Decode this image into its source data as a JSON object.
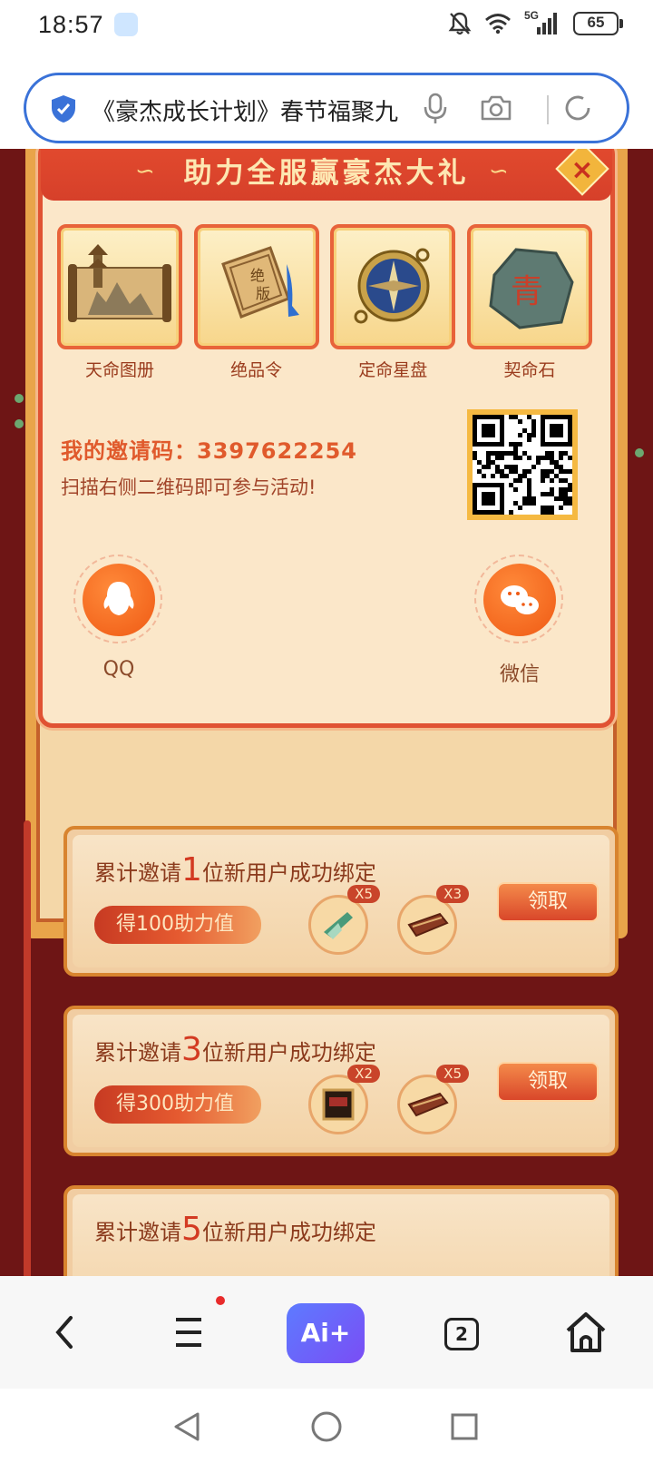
{
  "status": {
    "time": "18:57",
    "network": "5G",
    "battery": "65"
  },
  "browser": {
    "address_text": "《豪杰成长计划》春节福聚九",
    "tabs_count": "2",
    "ai_label": "Ai+"
  },
  "modal": {
    "title": "助力全服赢豪杰大礼",
    "items": [
      {
        "label": "天命图册"
      },
      {
        "label": "绝品令"
      },
      {
        "label": "定命星盘"
      },
      {
        "label": "契命石"
      }
    ],
    "invite_label": "我的邀请码：",
    "invite_code": "3397622254",
    "scan_text": "扫描右侧二维码即可参与活动!",
    "share": [
      {
        "label": "QQ"
      },
      {
        "label": "微信"
      }
    ]
  },
  "tasks": [
    {
      "prefix": "累计邀请",
      "num": "1",
      "suffix": "位新用户成功绑定",
      "badge": "得100助力值",
      "rewards": [
        "X5",
        "X3"
      ],
      "claim": "领取"
    },
    {
      "prefix": "累计邀请",
      "num": "3",
      "suffix": "位新用户成功绑定",
      "badge": "得300助力值",
      "rewards": [
        "X2",
        "X5"
      ],
      "claim": "领取"
    },
    {
      "prefix": "累计邀请",
      "num": "5",
      "suffix": "位新用户成功绑定"
    }
  ],
  "colors": {
    "accent_red": "#e05233",
    "bg_dark": "#6e1515",
    "browser_blue": "#3a72d8"
  }
}
